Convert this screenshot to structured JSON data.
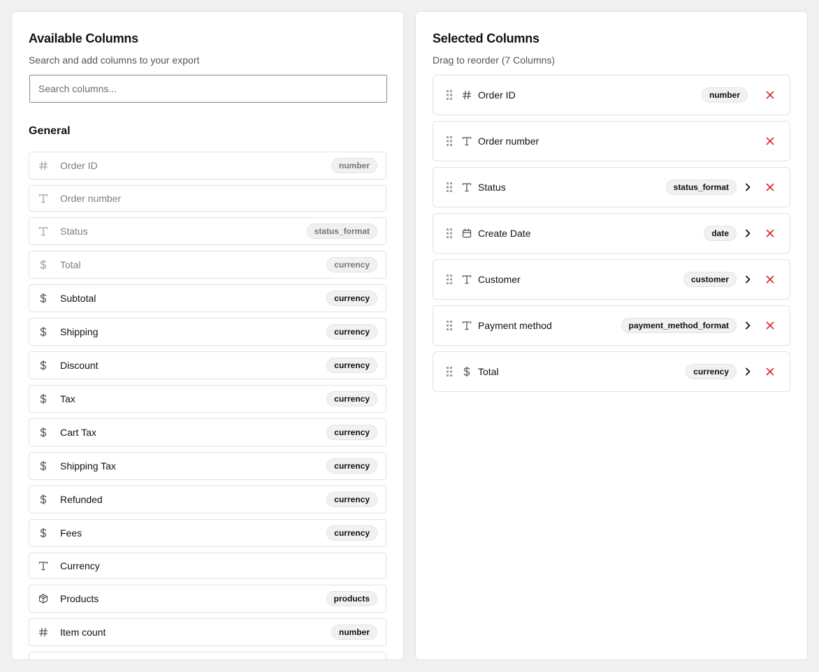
{
  "available": {
    "title": "Available Columns",
    "subtitle": "Search and add columns to your export",
    "search_placeholder": "Search columns...",
    "section_title": "General",
    "items": [
      {
        "label": "Order ID",
        "icon": "hash-icon",
        "badge": "number",
        "disabled": true
      },
      {
        "label": "Order number",
        "icon": "text-icon",
        "badge": "",
        "disabled": true
      },
      {
        "label": "Status",
        "icon": "text-icon",
        "badge": "status_format",
        "disabled": true
      },
      {
        "label": "Total",
        "icon": "dollar-icon",
        "badge": "currency",
        "disabled": true
      },
      {
        "label": "Subtotal",
        "icon": "dollar-icon",
        "badge": "currency",
        "disabled": false
      },
      {
        "label": "Shipping",
        "icon": "dollar-icon",
        "badge": "currency",
        "disabled": false
      },
      {
        "label": "Discount",
        "icon": "dollar-icon",
        "badge": "currency",
        "disabled": false
      },
      {
        "label": "Tax",
        "icon": "dollar-icon",
        "badge": "currency",
        "disabled": false
      },
      {
        "label": "Cart Tax",
        "icon": "dollar-icon",
        "badge": "currency",
        "disabled": false
      },
      {
        "label": "Shipping Tax",
        "icon": "dollar-icon",
        "badge": "currency",
        "disabled": false
      },
      {
        "label": "Refunded",
        "icon": "dollar-icon",
        "badge": "currency",
        "disabled": false
      },
      {
        "label": "Fees",
        "icon": "dollar-icon",
        "badge": "currency",
        "disabled": false
      },
      {
        "label": "Currency",
        "icon": "text-icon",
        "badge": "",
        "disabled": false
      },
      {
        "label": "Products",
        "icon": "package-icon",
        "badge": "products",
        "disabled": false
      },
      {
        "label": "Item count",
        "icon": "hash-icon",
        "badge": "number",
        "disabled": false
      },
      {
        "label": "",
        "icon": "",
        "badge": "",
        "disabled": false
      }
    ]
  },
  "selected": {
    "title": "Selected Columns",
    "subtitle": "Drag to reorder (7 Columns)",
    "items": [
      {
        "label": "Order ID",
        "icon": "hash-icon",
        "badge": "number",
        "expandable": false
      },
      {
        "label": "Order number",
        "icon": "text-icon",
        "badge": "",
        "expandable": false
      },
      {
        "label": "Status",
        "icon": "text-icon",
        "badge": "status_format",
        "expandable": true
      },
      {
        "label": "Create Date",
        "icon": "calendar-icon",
        "badge": "date",
        "expandable": true
      },
      {
        "label": "Customer",
        "icon": "text-icon",
        "badge": "customer",
        "expandable": true
      },
      {
        "label": "Payment method",
        "icon": "text-icon",
        "badge": "payment_method_format",
        "expandable": true
      },
      {
        "label": "Total",
        "icon": "dollar-icon",
        "badge": "currency",
        "expandable": true
      }
    ]
  }
}
